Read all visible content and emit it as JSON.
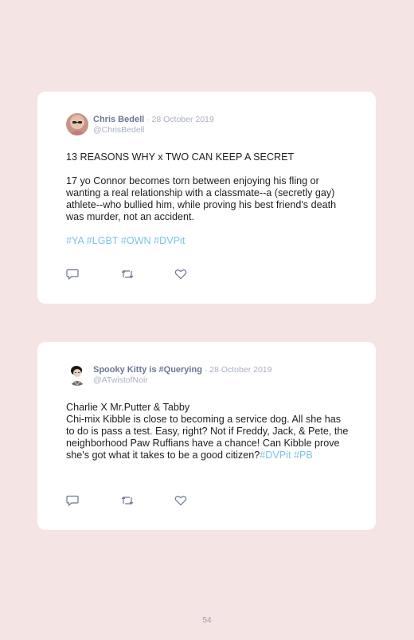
{
  "tweets": [
    {
      "name": "Chris Bedell",
      "date": " · 28 October 2019",
      "handle": "@ChrisBedell",
      "title": "13 REASONS WHY x TWO CAN KEEP A SECRET",
      "body": "17 yo Connor becomes torn between enjoying his fling or wanting a real relationship with a classmate--a (secretly gay) athlete--who bullied him, while proving his best friend's death was murder, not an accident.",
      "hashtags": "#YA #LGBT #OWN #DVPit",
      "avatar_icon": "profile-photo-icon"
    },
    {
      "name": "Spooky Kitty is #Querying",
      "date": " · 28 October 2019",
      "handle": "@ATwistofNoir",
      "title": "Charlie X Mr.Putter & Tabby",
      "body": "Chi-mix Kibble is close to becoming a service dog. All she has to do is pass a test. Easy, right? Not if Freddy, Jack, & Pete, the neighborhood Paw Ruffians have a chance! Can Kibble prove she's got what it takes to be a good citizen?",
      "hashtags": "#DVPit #PB",
      "avatar_icon": "profile-photo-icon"
    }
  ],
  "action_icons": [
    "reply-icon",
    "retweet-icon",
    "like-icon"
  ],
  "page_number": "54"
}
